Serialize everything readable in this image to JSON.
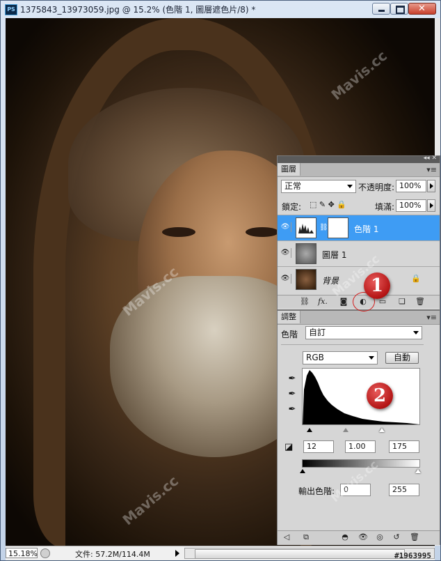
{
  "window": {
    "title": "1375843_13973059.jpg @ 15.2% (色階 1, 圖層遮色片/8) *",
    "app_icon": "PS"
  },
  "watermarks": [
    "Mavis.cc",
    "Mavis.cc",
    "Mavis.cc",
    "Mavis.cc",
    "Mavis.cc"
  ],
  "status": {
    "zoom": "15.18%",
    "doc_info": "文件: 57.2M/114.4M"
  },
  "layers_panel": {
    "tab_label": "圖層",
    "blend_mode": "正常",
    "opacity_label": "不透明度:",
    "opacity_value": "100%",
    "lock_label": "鎖定:",
    "fill_label": "填滿:",
    "fill_value": "100%",
    "layers": [
      {
        "name": "色階 1",
        "selected": true
      },
      {
        "name": "圖層 1",
        "selected": false
      },
      {
        "name": "背景",
        "selected": false
      }
    ],
    "toolbar_fx": "fx."
  },
  "adjustments_panel": {
    "tab_label": "調整",
    "type_label": "色階",
    "preset": "自訂",
    "channel": "RGB",
    "auto_button": "自動",
    "input_black": "12",
    "input_gamma": "1.00",
    "input_white": "175",
    "output_label": "輸出色階:",
    "output_black": "0",
    "output_white": "255"
  },
  "markers": {
    "one": "1",
    "two": "2"
  },
  "credit": "#1963995",
  "icons": {
    "eye": "eye-icon",
    "lock": "lock-icon",
    "dropper": "eyedropper-icon",
    "link": "link-icon",
    "trash": "trash-icon"
  },
  "colors": {
    "selection": "#3e9cf4",
    "marker": "#c81c1c",
    "panel": "#d6d6d6"
  }
}
